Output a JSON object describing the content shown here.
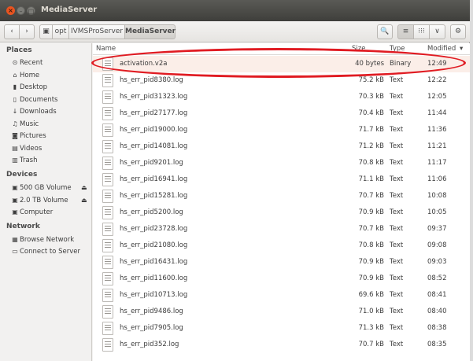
{
  "window": {
    "title": "MediaServer",
    "controls": {
      "close": "×",
      "minimize": "–",
      "maximize": "□"
    }
  },
  "toolbar": {
    "back": "‹",
    "forward": "›",
    "breadcrumb": [
      "opt",
      "IVMSProServer",
      "MediaServer"
    ],
    "search": "🔍",
    "list_view": "≡",
    "grid_view": "⁝⁝⁝",
    "options": "∨",
    "settings": "⚙"
  },
  "sidebar": {
    "places_heading": "Places",
    "places": [
      {
        "label": "Recent",
        "icon": "clock-icon",
        "glyph": "⊙"
      },
      {
        "label": "Home",
        "icon": "home-icon",
        "glyph": "⌂"
      },
      {
        "label": "Desktop",
        "icon": "desktop-icon",
        "glyph": "▮"
      },
      {
        "label": "Documents",
        "icon": "documents-icon",
        "glyph": "▯"
      },
      {
        "label": "Downloads",
        "icon": "download-icon",
        "glyph": "↓"
      },
      {
        "label": "Music",
        "icon": "music-icon",
        "glyph": "♫"
      },
      {
        "label": "Pictures",
        "icon": "camera-icon",
        "glyph": "◙"
      },
      {
        "label": "Videos",
        "icon": "video-icon",
        "glyph": "▤"
      },
      {
        "label": "Trash",
        "icon": "trash-icon",
        "glyph": "▥"
      }
    ],
    "devices_heading": "Devices",
    "devices": [
      {
        "label": "500 GB Volume",
        "icon": "drive-icon",
        "glyph": "▣",
        "eject": "⏏"
      },
      {
        "label": "2.0 TB Volume",
        "icon": "drive-icon",
        "glyph": "▣",
        "eject": "⏏"
      },
      {
        "label": "Computer",
        "icon": "computer-icon",
        "glyph": "▣"
      }
    ],
    "network_heading": "Network",
    "network": [
      {
        "label": "Browse Network",
        "icon": "network-icon",
        "glyph": "▦"
      },
      {
        "label": "Connect to Server",
        "icon": "server-icon",
        "glyph": "▭"
      }
    ]
  },
  "columns": {
    "name": "Name",
    "size": "Size",
    "type": "Type",
    "modified": "Modified",
    "sort_indicator": "▾"
  },
  "files": [
    {
      "name": "activation.v2a",
      "size": "40 bytes",
      "type": "Binary",
      "modified": "12:49"
    },
    {
      "name": "hs_err_pid8380.log",
      "size": "75.2 kB",
      "type": "Text",
      "modified": "12:22"
    },
    {
      "name": "hs_err_pid31323.log",
      "size": "70.3 kB",
      "type": "Text",
      "modified": "12:05"
    },
    {
      "name": "hs_err_pid27177.log",
      "size": "70.4 kB",
      "type": "Text",
      "modified": "11:44"
    },
    {
      "name": "hs_err_pid19000.log",
      "size": "71.7 kB",
      "type": "Text",
      "modified": "11:36"
    },
    {
      "name": "hs_err_pid14081.log",
      "size": "71.2 kB",
      "type": "Text",
      "modified": "11:21"
    },
    {
      "name": "hs_err_pid9201.log",
      "size": "70.8 kB",
      "type": "Text",
      "modified": "11:17"
    },
    {
      "name": "hs_err_pid16941.log",
      "size": "71.1 kB",
      "type": "Text",
      "modified": "11:06"
    },
    {
      "name": "hs_err_pid15281.log",
      "size": "70.7 kB",
      "type": "Text",
      "modified": "10:08"
    },
    {
      "name": "hs_err_pid5200.log",
      "size": "70.9 kB",
      "type": "Text",
      "modified": "10:05"
    },
    {
      "name": "hs_err_pid23728.log",
      "size": "70.7 kB",
      "type": "Text",
      "modified": "09:37"
    },
    {
      "name": "hs_err_pid21080.log",
      "size": "70.8 kB",
      "type": "Text",
      "modified": "09:08"
    },
    {
      "name": "hs_err_pid16431.log",
      "size": "70.9 kB",
      "type": "Text",
      "modified": "09:03"
    },
    {
      "name": "hs_err_pid11600.log",
      "size": "70.9 kB",
      "type": "Text",
      "modified": "08:52"
    },
    {
      "name": "hs_err_pid10713.log",
      "size": "69.6 kB",
      "type": "Text",
      "modified": "08:41"
    },
    {
      "name": "hs_err_pid9486.log",
      "size": "71.0 kB",
      "type": "Text",
      "modified": "08:40"
    },
    {
      "name": "hs_err_pid7905.log",
      "size": "71.3 kB",
      "type": "Text",
      "modified": "08:38"
    },
    {
      "name": "hs_err_pid352.log",
      "size": "70.7 kB",
      "type": "Text",
      "modified": "08:35"
    }
  ],
  "colors": {
    "accent": "#e95420",
    "highlight_ring": "#e01b22",
    "selected_row": "#fbeee8"
  }
}
